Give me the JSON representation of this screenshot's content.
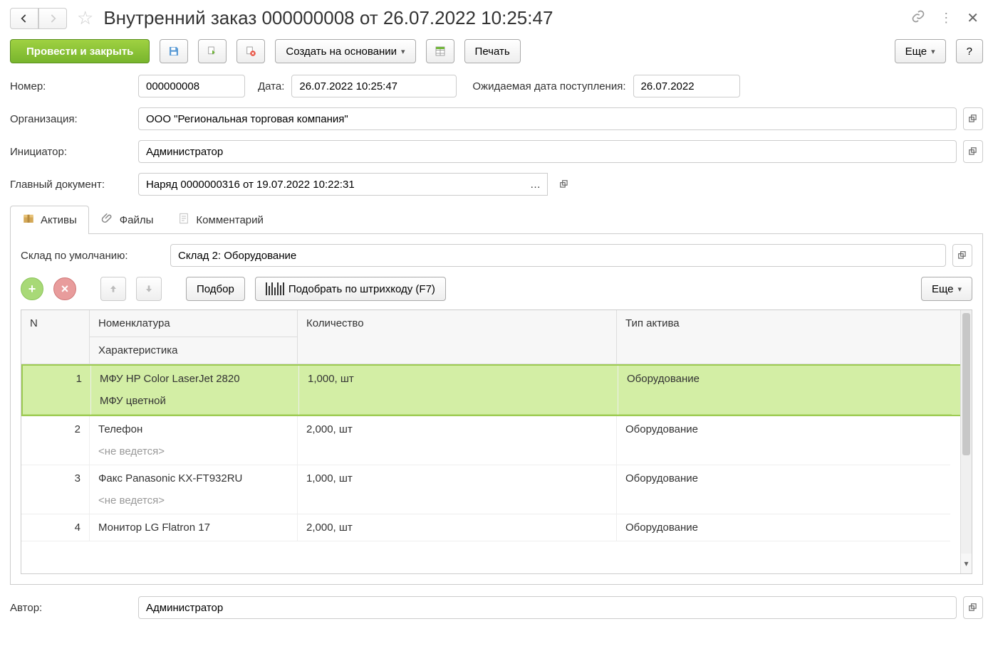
{
  "header": {
    "title": "Внутренний заказ 000000008 от 26.07.2022 10:25:47"
  },
  "toolbar": {
    "post_close": "Провести и закрыть",
    "create_based": "Создать на основании",
    "print": "Печать",
    "more": "Еще",
    "help": "?"
  },
  "fields": {
    "number_label": "Номер:",
    "number": "000000008",
    "date_label": "Дата:",
    "date": "26.07.2022 10:25:47",
    "expected_label": "Ожидаемая дата поступления:",
    "expected": "26.07.2022",
    "org_label": "Организация:",
    "org": "ООО \"Региональная торговая компания\"",
    "initiator_label": "Инициатор:",
    "initiator": "Администратор",
    "main_doc_label": "Главный документ:",
    "main_doc": "Наряд 0000000316 от 19.07.2022 10:22:31",
    "default_wh_label": "Склад по умолчанию:",
    "default_wh": "Склад 2: Оборудование",
    "author_label": "Автор:",
    "author": "Администратор"
  },
  "tabs": {
    "assets": "Активы",
    "files": "Файлы",
    "comment": "Комментарий"
  },
  "grid": {
    "toolbar": {
      "podbor": "Подбор",
      "barcode": "Подобрать по штрихкоду (F7)",
      "more": "Еще"
    },
    "columns": {
      "n": "N",
      "nomen": "Номенклатура",
      "charact": "Характеристика",
      "qty": "Количество",
      "asset_type": "Тип актива"
    },
    "rows": [
      {
        "n": "1",
        "nomen": "МФУ HP Color LaserJet 2820",
        "char": "МФУ цветной",
        "qty": "1,000, шт",
        "type": "Оборудование",
        "selected": true,
        "char_muted": false
      },
      {
        "n": "2",
        "nomen": "Телефон",
        "char": "<не ведется>",
        "qty": "2,000, шт",
        "type": "Оборудование",
        "char_muted": true
      },
      {
        "n": "3",
        "nomen": "Факс Panasonic KX-FT932RU",
        "char": "<не ведется>",
        "qty": "1,000, шт",
        "type": "Оборудование",
        "char_muted": true
      },
      {
        "n": "4",
        "nomen": "Монитор LG Flatron 17",
        "char": "",
        "qty": "2,000, шт",
        "type": "Оборудование"
      }
    ]
  }
}
